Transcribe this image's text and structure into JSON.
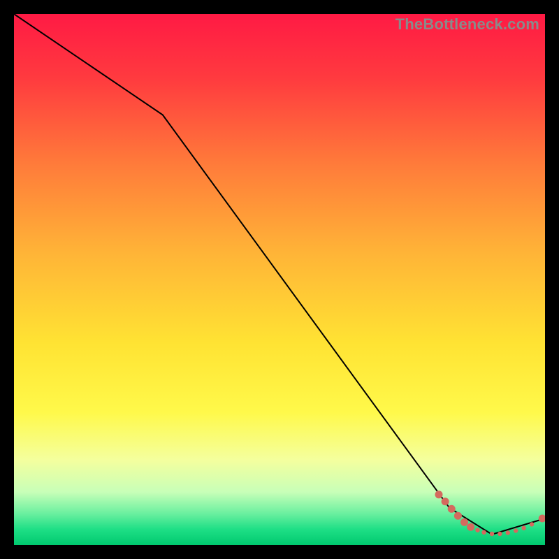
{
  "watermark": "TheBottleneck.com",
  "chart_data": {
    "type": "line",
    "title": "",
    "xlabel": "",
    "ylabel": "",
    "xlim": [
      0,
      100
    ],
    "ylim": [
      0,
      100
    ],
    "grid": false,
    "background_gradient": {
      "stops": [
        {
          "pct": 0,
          "color": "#ff1a44"
        },
        {
          "pct": 12,
          "color": "#ff3a3f"
        },
        {
          "pct": 28,
          "color": "#ff7a3a"
        },
        {
          "pct": 45,
          "color": "#ffb437"
        },
        {
          "pct": 62,
          "color": "#ffe333"
        },
        {
          "pct": 75,
          "color": "#fff94a"
        },
        {
          "pct": 84,
          "color": "#f4ff9e"
        },
        {
          "pct": 90,
          "color": "#c8ffb8"
        },
        {
          "pct": 94,
          "color": "#6cf0a0"
        },
        {
          "pct": 97,
          "color": "#1fdf86"
        },
        {
          "pct": 100,
          "color": "#00c96f"
        }
      ]
    },
    "series": [
      {
        "name": "main-line",
        "color": "#000000",
        "width": 2,
        "x": [
          0,
          28,
          82,
          90,
          100
        ],
        "y": [
          100,
          81,
          7,
          2,
          5
        ]
      }
    ],
    "markers": {
      "name": "highlight-points",
      "color": "#d46a5e",
      "shape": "circle",
      "radius_large": 5.5,
      "radius_small": 3.2,
      "points": [
        {
          "x": 80.0,
          "y": 9.5,
          "r": "large"
        },
        {
          "x": 81.2,
          "y": 8.2,
          "r": "large"
        },
        {
          "x": 82.4,
          "y": 6.8,
          "r": "large"
        },
        {
          "x": 83.6,
          "y": 5.5,
          "r": "large"
        },
        {
          "x": 84.8,
          "y": 4.3,
          "r": "large"
        },
        {
          "x": 86.0,
          "y": 3.4,
          "r": "large"
        },
        {
          "x": 87.3,
          "y": 2.8,
          "r": "small"
        },
        {
          "x": 88.5,
          "y": 2.4,
          "r": "small"
        },
        {
          "x": 90.0,
          "y": 2.1,
          "r": "small"
        },
        {
          "x": 91.5,
          "y": 2.1,
          "r": "small"
        },
        {
          "x": 93.0,
          "y": 2.3,
          "r": "small"
        },
        {
          "x": 94.5,
          "y": 2.7,
          "r": "small"
        },
        {
          "x": 96.0,
          "y": 3.2,
          "r": "small"
        },
        {
          "x": 97.5,
          "y": 3.9,
          "r": "small"
        },
        {
          "x": 99.5,
          "y": 5.0,
          "r": "large"
        }
      ]
    }
  }
}
